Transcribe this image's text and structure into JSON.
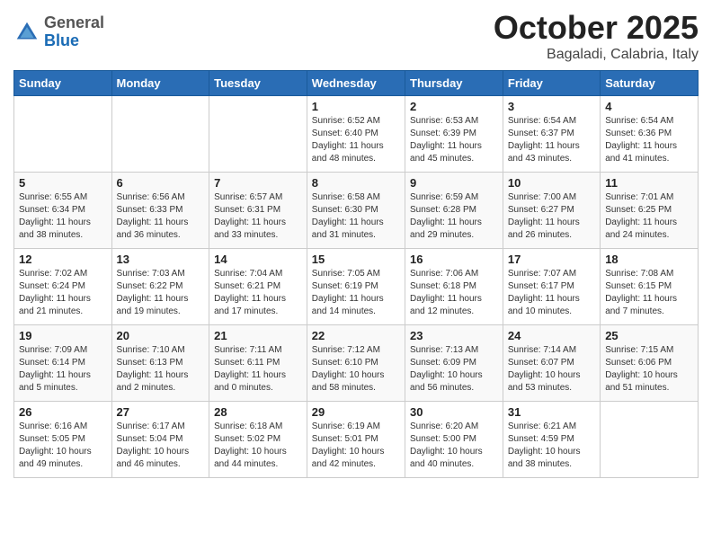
{
  "header": {
    "logo": {
      "general": "General",
      "blue": "Blue"
    },
    "title": "October 2025",
    "location": "Bagaladi, Calabria, Italy"
  },
  "calendar": {
    "days_of_week": [
      "Sunday",
      "Monday",
      "Tuesday",
      "Wednesday",
      "Thursday",
      "Friday",
      "Saturday"
    ],
    "weeks": [
      [
        {
          "day": "",
          "info": ""
        },
        {
          "day": "",
          "info": ""
        },
        {
          "day": "",
          "info": ""
        },
        {
          "day": "1",
          "info": "Sunrise: 6:52 AM\nSunset: 6:40 PM\nDaylight: 11 hours\nand 48 minutes."
        },
        {
          "day": "2",
          "info": "Sunrise: 6:53 AM\nSunset: 6:39 PM\nDaylight: 11 hours\nand 45 minutes."
        },
        {
          "day": "3",
          "info": "Sunrise: 6:54 AM\nSunset: 6:37 PM\nDaylight: 11 hours\nand 43 minutes."
        },
        {
          "day": "4",
          "info": "Sunrise: 6:54 AM\nSunset: 6:36 PM\nDaylight: 11 hours\nand 41 minutes."
        }
      ],
      [
        {
          "day": "5",
          "info": "Sunrise: 6:55 AM\nSunset: 6:34 PM\nDaylight: 11 hours\nand 38 minutes."
        },
        {
          "day": "6",
          "info": "Sunrise: 6:56 AM\nSunset: 6:33 PM\nDaylight: 11 hours\nand 36 minutes."
        },
        {
          "day": "7",
          "info": "Sunrise: 6:57 AM\nSunset: 6:31 PM\nDaylight: 11 hours\nand 33 minutes."
        },
        {
          "day": "8",
          "info": "Sunrise: 6:58 AM\nSunset: 6:30 PM\nDaylight: 11 hours\nand 31 minutes."
        },
        {
          "day": "9",
          "info": "Sunrise: 6:59 AM\nSunset: 6:28 PM\nDaylight: 11 hours\nand 29 minutes."
        },
        {
          "day": "10",
          "info": "Sunrise: 7:00 AM\nSunset: 6:27 PM\nDaylight: 11 hours\nand 26 minutes."
        },
        {
          "day": "11",
          "info": "Sunrise: 7:01 AM\nSunset: 6:25 PM\nDaylight: 11 hours\nand 24 minutes."
        }
      ],
      [
        {
          "day": "12",
          "info": "Sunrise: 7:02 AM\nSunset: 6:24 PM\nDaylight: 11 hours\nand 21 minutes."
        },
        {
          "day": "13",
          "info": "Sunrise: 7:03 AM\nSunset: 6:22 PM\nDaylight: 11 hours\nand 19 minutes."
        },
        {
          "day": "14",
          "info": "Sunrise: 7:04 AM\nSunset: 6:21 PM\nDaylight: 11 hours\nand 17 minutes."
        },
        {
          "day": "15",
          "info": "Sunrise: 7:05 AM\nSunset: 6:19 PM\nDaylight: 11 hours\nand 14 minutes."
        },
        {
          "day": "16",
          "info": "Sunrise: 7:06 AM\nSunset: 6:18 PM\nDaylight: 11 hours\nand 12 minutes."
        },
        {
          "day": "17",
          "info": "Sunrise: 7:07 AM\nSunset: 6:17 PM\nDaylight: 11 hours\nand 10 minutes."
        },
        {
          "day": "18",
          "info": "Sunrise: 7:08 AM\nSunset: 6:15 PM\nDaylight: 11 hours\nand 7 minutes."
        }
      ],
      [
        {
          "day": "19",
          "info": "Sunrise: 7:09 AM\nSunset: 6:14 PM\nDaylight: 11 hours\nand 5 minutes."
        },
        {
          "day": "20",
          "info": "Sunrise: 7:10 AM\nSunset: 6:13 PM\nDaylight: 11 hours\nand 2 minutes."
        },
        {
          "day": "21",
          "info": "Sunrise: 7:11 AM\nSunset: 6:11 PM\nDaylight: 11 hours\nand 0 minutes."
        },
        {
          "day": "22",
          "info": "Sunrise: 7:12 AM\nSunset: 6:10 PM\nDaylight: 10 hours\nand 58 minutes."
        },
        {
          "day": "23",
          "info": "Sunrise: 7:13 AM\nSunset: 6:09 PM\nDaylight: 10 hours\nand 56 minutes."
        },
        {
          "day": "24",
          "info": "Sunrise: 7:14 AM\nSunset: 6:07 PM\nDaylight: 10 hours\nand 53 minutes."
        },
        {
          "day": "25",
          "info": "Sunrise: 7:15 AM\nSunset: 6:06 PM\nDaylight: 10 hours\nand 51 minutes."
        }
      ],
      [
        {
          "day": "26",
          "info": "Sunrise: 6:16 AM\nSunset: 5:05 PM\nDaylight: 10 hours\nand 49 minutes."
        },
        {
          "day": "27",
          "info": "Sunrise: 6:17 AM\nSunset: 5:04 PM\nDaylight: 10 hours\nand 46 minutes."
        },
        {
          "day": "28",
          "info": "Sunrise: 6:18 AM\nSunset: 5:02 PM\nDaylight: 10 hours\nand 44 minutes."
        },
        {
          "day": "29",
          "info": "Sunrise: 6:19 AM\nSunset: 5:01 PM\nDaylight: 10 hours\nand 42 minutes."
        },
        {
          "day": "30",
          "info": "Sunrise: 6:20 AM\nSunset: 5:00 PM\nDaylight: 10 hours\nand 40 minutes."
        },
        {
          "day": "31",
          "info": "Sunrise: 6:21 AM\nSunset: 4:59 PM\nDaylight: 10 hours\nand 38 minutes."
        },
        {
          "day": "",
          "info": ""
        }
      ]
    ]
  }
}
